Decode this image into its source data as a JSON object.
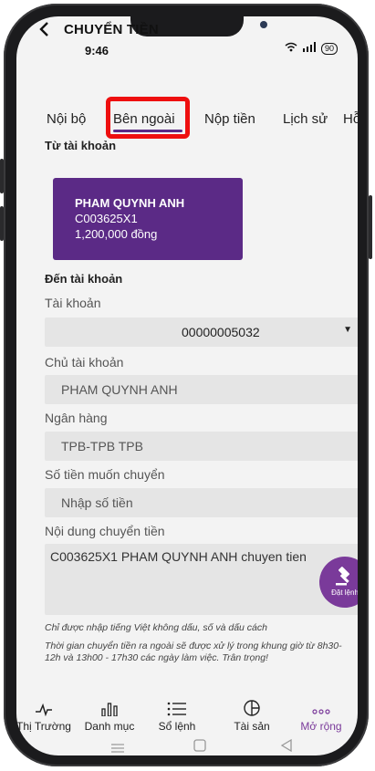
{
  "status": {
    "time": "9:46",
    "battery": "90"
  },
  "header": {
    "back_icon": "chevron-left-icon",
    "title": "CHUYỂN TIỀN"
  },
  "tabs": [
    {
      "label": "Nội bộ"
    },
    {
      "label": "Bên ngoài",
      "active": true
    },
    {
      "label": "Nộp tiền"
    },
    {
      "label": "Lịch sử"
    },
    {
      "label": "Hỗ"
    }
  ],
  "from_section": {
    "label": "Từ tài khoản",
    "card": {
      "name": "PHAM QUYNH ANH",
      "account": "C003625X1",
      "balance": "1,200,000 đồng"
    }
  },
  "to_section": {
    "label": "Đến tài khoản",
    "account_label": "Tài khoản",
    "account_value": "00000005032",
    "holder_label": "Chủ tài khoản",
    "holder_value": "PHAM QUYNH ANH",
    "bank_label": "Ngân hàng",
    "bank_value": "TPB-TPB TPB",
    "amount_label": "Số tiền muốn chuyển",
    "amount_placeholder": "Nhập số tiền",
    "content_label": "Nội dung chuyển tiền",
    "content_value": "C003625X1 PHAM QUYNH ANH chuyen tien"
  },
  "notes": {
    "note1": "Chỉ được nhập tiếng Việt không dấu, số và dấu cách",
    "note2": "Thời gian chuyển tiền ra ngoài sẽ được xử lý trong khung giờ từ 8h30-12h và 13h00 - 17h30 các ngày làm việc. Trân trọng!"
  },
  "fab": {
    "label": "Đặt lệnh",
    "icon": "gavel-icon"
  },
  "bottom_nav": [
    {
      "label": "Thị Trường",
      "icon": "pulse-icon"
    },
    {
      "label": "Danh mục",
      "icon": "bar-chart-icon"
    },
    {
      "label": "Sổ lệnh",
      "icon": "list-icon"
    },
    {
      "label": "Tài sản",
      "icon": "pie-icon"
    },
    {
      "label": "Mở rộng",
      "icon": "more-icon",
      "active": true
    }
  ],
  "colors": {
    "brand": "#5b2a86",
    "accent": "#7a3a9a",
    "highlight": "#ee0f0f"
  }
}
